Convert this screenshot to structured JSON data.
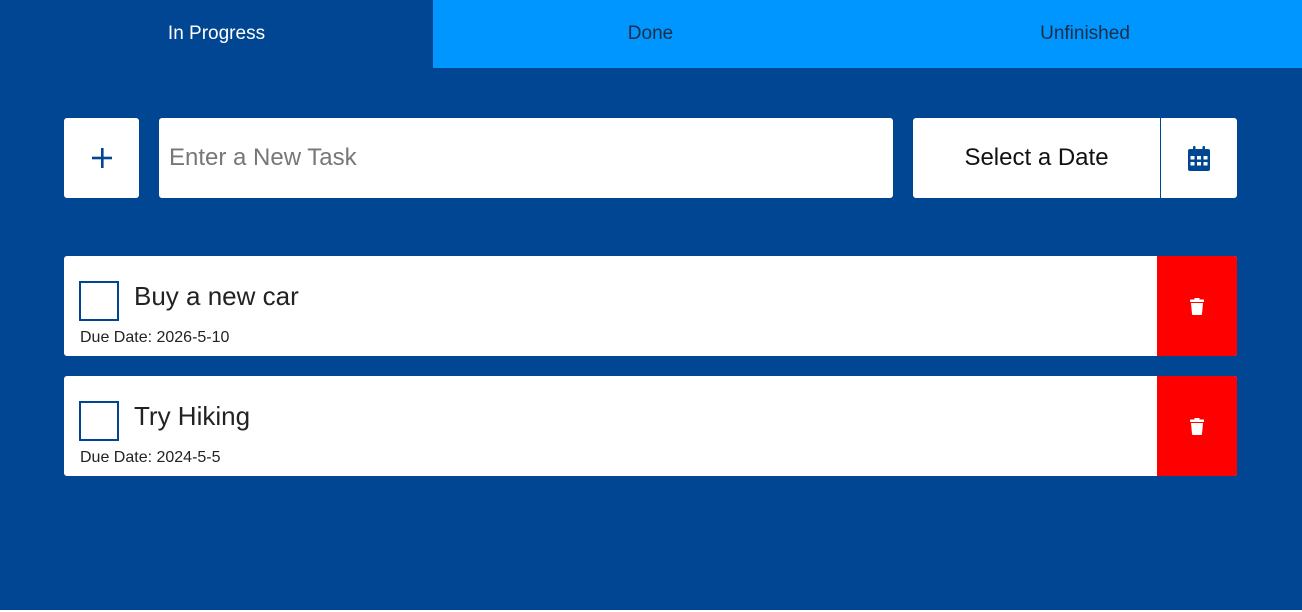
{
  "tabs": [
    {
      "label": "In Progress",
      "active": true
    },
    {
      "label": "Done",
      "active": false
    },
    {
      "label": "Unfinished",
      "active": false
    }
  ],
  "new_task": {
    "add_icon": "plus-icon",
    "placeholder": "Enter a New Task",
    "value": "",
    "date_label": "Select a Date",
    "calendar_icon": "calendar-icon"
  },
  "tasks": [
    {
      "title": "Buy a new car",
      "due": "Due Date: 2026-5-10",
      "checked": false,
      "delete_icon": "trash-icon"
    },
    {
      "title": "Try Hiking",
      "due": "Due Date: 2024-5-5",
      "checked": false,
      "delete_icon": "trash-icon"
    }
  ],
  "colors": {
    "background": "#004692",
    "tab_inactive": "#0096ff",
    "delete": "#ff0000",
    "surface": "#ffffff"
  }
}
